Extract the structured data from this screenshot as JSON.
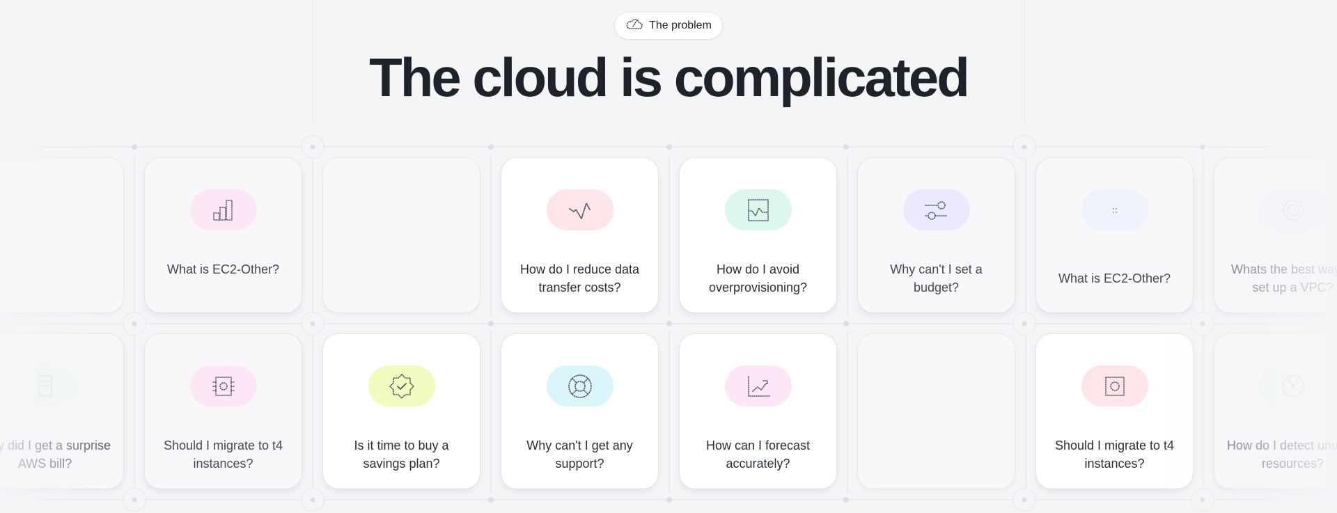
{
  "header": {
    "badge_icon": "cloud-icon",
    "badge_label": "The problem",
    "title": "The cloud is complicated"
  },
  "colors": {
    "background": "#f5f5f8",
    "title": "#1e222b",
    "pill_pink": "#fde7f6",
    "pill_rose": "#fde5ea",
    "pill_mint": "#dcf8ec",
    "pill_lavender": "#eae9fd",
    "pill_blue": "#e9effc",
    "pill_lime": "#f1fbc0",
    "pill_cyan": "#d9f7fb"
  },
  "cards_row1": [
    {
      "question": "",
      "icon": "",
      "state": "empty"
    },
    {
      "question": "What is EC2-Other?",
      "icon": "bar-chart-icon",
      "state": "dim"
    },
    {
      "question": "",
      "icon": "",
      "state": "empty"
    },
    {
      "question": "How do I reduce data transfer costs?",
      "icon": "zigzag-line-icon",
      "state": "active"
    },
    {
      "question": "How do I avoid overprovisioning?",
      "icon": "line-chart-box-icon",
      "state": "active"
    },
    {
      "question": "Why can't I set a budget?",
      "icon": "sliders-toggle-icon",
      "state": "dim"
    },
    {
      "question": "What is EC2-Other?",
      "icon": "dots-icon",
      "state": "faded"
    },
    {
      "question": "Whats the best way to set up a VPC?",
      "icon": "target-icon",
      "state": "faded"
    }
  ],
  "cards_row2": [
    {
      "question": "Why did I get a surprise AWS bill?",
      "icon": "receipt-icon",
      "state": "faded"
    },
    {
      "question": "Should I migrate to t4 instances?",
      "icon": "cpu-chip-icon",
      "state": "dim"
    },
    {
      "question": "Is it time to buy a savings plan?",
      "icon": "badge-check-icon",
      "state": "active"
    },
    {
      "question": "Why can't I get any support?",
      "icon": "lifebuoy-icon",
      "state": "active"
    },
    {
      "question": "How can I forecast accurately?",
      "icon": "trend-chart-icon",
      "state": "active"
    },
    {
      "question": "",
      "icon": "",
      "state": "empty"
    },
    {
      "question": "Should I migrate to t4 instances?",
      "icon": "cpu-chip-icon",
      "state": "active"
    },
    {
      "question": "How do I detect unused resources?",
      "icon": "radar-icon",
      "state": "faded"
    }
  ]
}
